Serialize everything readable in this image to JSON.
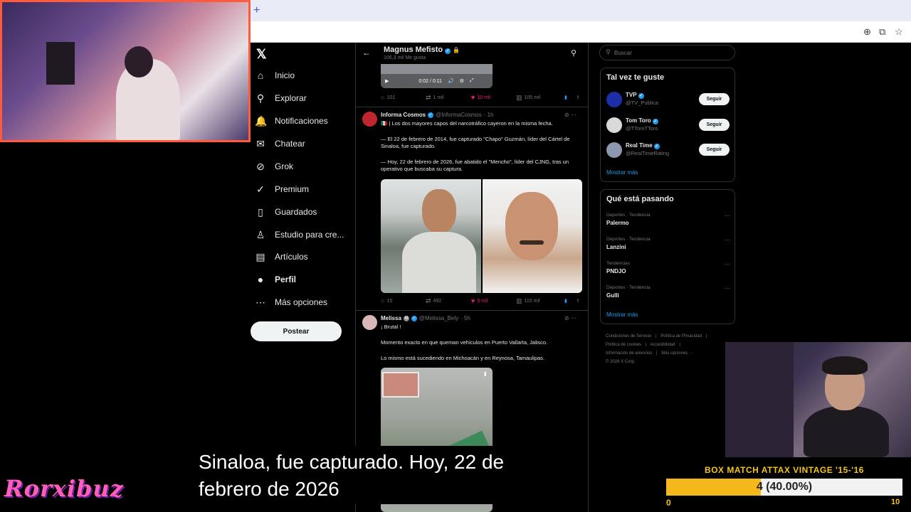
{
  "browser": {
    "new_tab": "+",
    "toolbar_icons": [
      "zoom-icon",
      "install-icon",
      "star-icon"
    ]
  },
  "nav": {
    "logo": "𝕏",
    "items": [
      {
        "label": "Inicio",
        "icon": "home-icon",
        "glyph": "⌂"
      },
      {
        "label": "Explorar",
        "icon": "search-icon",
        "glyph": "⚲"
      },
      {
        "label": "Notificaciones",
        "icon": "bell-icon",
        "glyph": "🔔"
      },
      {
        "label": "Chatear",
        "icon": "mail-icon",
        "glyph": "✉"
      },
      {
        "label": "Grok",
        "icon": "grok-icon",
        "glyph": "⊘"
      },
      {
        "label": "Premium",
        "icon": "premium-icon",
        "glyph": "✓"
      },
      {
        "label": "Guardados",
        "icon": "bookmark-icon",
        "glyph": "▯"
      },
      {
        "label": "Estudio para cre...",
        "icon": "studio-icon",
        "glyph": "♙"
      },
      {
        "label": "Artículos",
        "icon": "articles-icon",
        "glyph": "▤"
      },
      {
        "label": "Perfil",
        "icon": "profile-icon",
        "glyph": "●"
      },
      {
        "label": "Más opciones",
        "icon": "more-icon",
        "glyph": "⋯"
      }
    ],
    "post_label": "Postear"
  },
  "timeline": {
    "header_name": "Magnus Mefisto",
    "header_sub": "106,3 mil Me gusta",
    "video_time": "0:02 / 0:11",
    "first_actions": {
      "replies": "101",
      "reposts": "1 mil",
      "likes": "10 mil",
      "views": "105 mil"
    },
    "tweets": [
      {
        "name": "Informa Cosmos",
        "handle": "@InformaCosmos",
        "time": "· 1h",
        "lines": [
          "🇲🇽 | Los dos mayores capos del narcotráfico cayeron en la misma fecha.",
          "— El 22 de febrero de 2014, fue capturado \"Chapo\" Guzmán, líder del Cártel de Sinaloa, fue capturado.",
          "— Hoy, 22 de febrero de 2026, fue abatido el \"Mencho\", líder del CJNG, tras un operativo que buscaba su captura."
        ],
        "actions": {
          "replies": "15",
          "reposts": "492",
          "likes": "5 mil",
          "views": "115 mil"
        }
      },
      {
        "name": "Melissa",
        "handle": "@Melissa_Bely",
        "time": "· 5h",
        "lines": [
          "¡ Brutal !",
          "Momento exacto en que queman vehículos en Puerto Vallarta, Jalisco.",
          "Lo mismo está sucediendo en Michoacán y en Reynosa, Tamaulipas."
        ]
      }
    ]
  },
  "sidebar": {
    "search_placeholder": "Buscar",
    "who_title": "Tal vez te guste",
    "who": [
      {
        "name": "TVP",
        "handle": "@TV_Publica",
        "follow": "Seguir",
        "color": "#1c2fa8"
      },
      {
        "name": "Tom Toro",
        "handle": "@TTomTToro",
        "follow": "Seguir",
        "color": "#d9d9d9"
      },
      {
        "name": "Real Time",
        "handle": "@RealTimeRating",
        "follow": "Seguir",
        "color": "#8c97b0"
      }
    ],
    "who_more": "Mostrar más",
    "trends_title": "Qué está pasando",
    "trends": [
      {
        "category": "Deportes · Tendencia",
        "name": "Palermo"
      },
      {
        "category": "Deportes · Tendencia",
        "name": "Lanzini"
      },
      {
        "category": "Tendencias",
        "name": "PNDJO"
      },
      {
        "category": "Deportes · Tendencia",
        "name": "Gulli"
      }
    ],
    "trends_more": "Mostrar más",
    "footer": [
      "Condiciones de Servicio",
      "|",
      "Política de Privacidad",
      "|",
      "Política de cookies",
      "|",
      "Accesibilidad",
      "|",
      "Información de anuncios",
      "|",
      "Más opciones ···",
      "© 2026 X Corp."
    ]
  },
  "overlay": {
    "subtitle_line1": "Sinaloa, fue capturado. Hoy, 22 de",
    "subtitle_line2": "febrero de 2026",
    "brand": "Rorxibuz",
    "box_title": "BOX MATCH ATTAX VINTAGE '15-'16",
    "box_label": "4 (40.00%)",
    "box_progress": 0.4,
    "box_min": "0",
    "box_max": "10"
  },
  "colors": {
    "accent": "#1d9bf0",
    "like": "#f91880",
    "progress": "#f5b81c"
  }
}
